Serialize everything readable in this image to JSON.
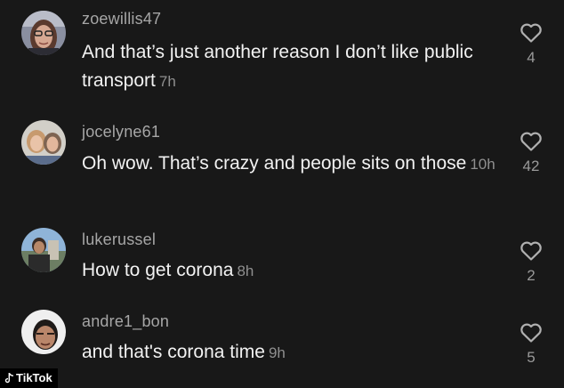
{
  "comments": [
    {
      "username": "zoewillis47",
      "text": "And that’s just another reason I don’t like public transport",
      "time": "7h",
      "likes": "4",
      "avatar_icon": "avatar-woman-glasses"
    },
    {
      "username": "jocelyne61",
      "text": "Oh wow. That’s crazy and people sits on those",
      "time": "10h",
      "likes": "42",
      "avatar_icon": "avatar-two-women"
    },
    {
      "username": "lukerussel",
      "text": "How to get corona",
      "time": "8h",
      "likes": "2",
      "avatar_icon": "avatar-man-outdoors"
    },
    {
      "username": "andre1_bon",
      "text": "and that's corona time",
      "time": "9h",
      "likes": "5",
      "avatar_icon": "avatar-man-selfie"
    }
  ],
  "like_icon": "heart-outline-icon",
  "watermark": {
    "label": "TikTok",
    "icon": "tiktok-note-icon"
  },
  "colors": {
    "background": "#181818",
    "username": "#a6a6a6",
    "text": "#f2f2f2",
    "meta": "#8f8f8f"
  }
}
